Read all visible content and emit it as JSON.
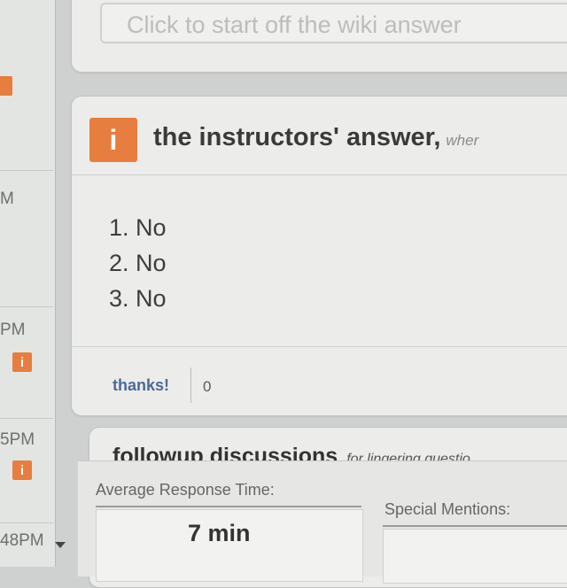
{
  "feed": {
    "items": [
      {
        "time": "",
        "has_badge": true
      },
      {
        "time": "M",
        "has_badge": false
      },
      {
        "time": "PM",
        "has_badge": true
      },
      {
        "time": "5PM",
        "has_badge": true
      },
      {
        "time": "48PM",
        "has_badge": true
      }
    ]
  },
  "wiki": {
    "placeholder": "Click to start off the wiki answer"
  },
  "answer": {
    "badge_icon": "i",
    "title": "the instructors' answer,",
    "subtitle": "wher",
    "items": [
      "1. No",
      "2. No",
      "3. No"
    ],
    "thanks_label": "thanks!",
    "thanks_count": "0"
  },
  "followup": {
    "title": "followup discussions",
    "subtitle": "for lingering questio"
  },
  "stats": {
    "avg_label": "Average Response Time:",
    "avg_value": "7 min",
    "mentions_label": "Special Mentions:"
  },
  "colors": {
    "accent": "#e77d3e",
    "link": "#4a6a96"
  }
}
